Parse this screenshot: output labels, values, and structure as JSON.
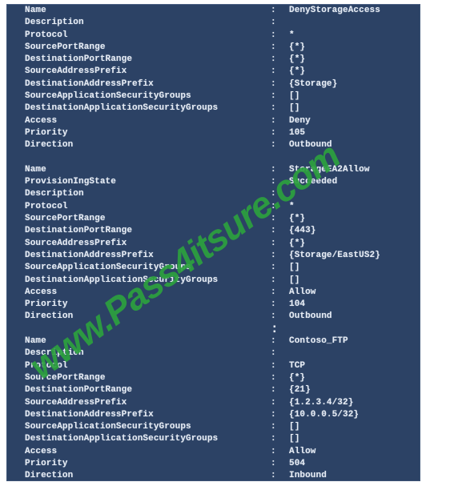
{
  "console": {
    "background_color": "#2c4265",
    "text_color": "#e6ecf5",
    "separator": ":"
  },
  "watermark": {
    "text": "www.Pass4itsure.com",
    "color": "#2da13f"
  },
  "rules": [
    {
      "id": "rule-deny-storage-access",
      "leading_spacer": false,
      "leading_spacer_colon": false,
      "rows": [
        {
          "label": "Name",
          "value": "DenyStorageAccess"
        },
        {
          "label": "Description",
          "value": ""
        },
        {
          "label": "Protocol",
          "value": "*"
        },
        {
          "label": "SourcePortRange",
          "value": "{*}"
        },
        {
          "label": "DestinationPortRange",
          "value": "{*}"
        },
        {
          "label": "SourceAddressPrefix",
          "value": "{*}"
        },
        {
          "label": "DestinationAddressPrefix",
          "value": "{Storage}"
        },
        {
          "label": "SourceApplicationSecurityGroups",
          "value": "[]"
        },
        {
          "label": "DestinationApplicationSecurityGroups",
          "value": "[]"
        },
        {
          "label": "Access",
          "value": "Deny"
        },
        {
          "label": "Priority",
          "value": "105"
        },
        {
          "label": "Direction",
          "value": "Outbound"
        }
      ]
    },
    {
      "id": "rule-storage-ea2-allow",
      "leading_spacer": true,
      "leading_spacer_colon": false,
      "rows": [
        {
          "label": "Name",
          "value": "StorageEA2Allow"
        },
        {
          "label": "ProvisionIngState",
          "value": "Succeeded"
        },
        {
          "label": "Description",
          "value": ""
        },
        {
          "label": "Protocol",
          "value": "*"
        },
        {
          "label": "SourcePortRange",
          "value": "{*}"
        },
        {
          "label": "DestinationPortRange",
          "value": "{443}"
        },
        {
          "label": "SourceAddressPrefix",
          "value": "{*}"
        },
        {
          "label": "DestinationAddressPrefix",
          "value": "{Storage/EastUS2}"
        },
        {
          "label": "SourceApplicationSecurityGroups",
          "value": "[]"
        },
        {
          "label": "DestinationApplicationSecurityGroups",
          "value": "[]"
        },
        {
          "label": "Access",
          "value": "Allow"
        },
        {
          "label": "Priority",
          "value": "104"
        },
        {
          "label": "Direction",
          "value": "Outbound"
        }
      ]
    },
    {
      "id": "rule-contoso-ftp",
      "leading_spacer": true,
      "leading_spacer_colon": true,
      "rows": [
        {
          "label": "Name",
          "value": "Contoso_FTP"
        },
        {
          "label": "Description",
          "value": ""
        },
        {
          "label": "Protocol",
          "value": "TCP"
        },
        {
          "label": "SourcePortRange",
          "value": "{*}"
        },
        {
          "label": "DestinationPortRange",
          "value": "{21}"
        },
        {
          "label": "SourceAddressPrefix",
          "value": "{1.2.3.4/32}"
        },
        {
          "label": "DestinationAddressPrefix",
          "value": "{10.0.0.5/32}"
        },
        {
          "label": "SourceApplicationSecurityGroups",
          "value": "[]"
        },
        {
          "label": "DestinationApplicationSecurityGroups",
          "value": "[]"
        },
        {
          "label": "Access",
          "value": "Allow"
        },
        {
          "label": "Priority",
          "value": "504"
        },
        {
          "label": "Direction",
          "value": "Inbound"
        }
      ]
    }
  ]
}
